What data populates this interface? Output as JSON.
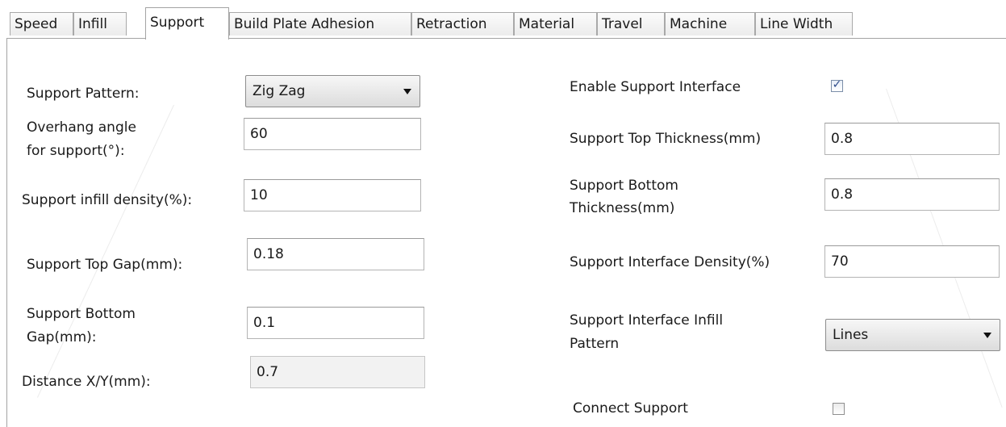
{
  "tabs": [
    {
      "label": "Speed",
      "active": false
    },
    {
      "label": "Infill",
      "active": false
    },
    {
      "label": "Support",
      "active": true
    },
    {
      "label": "Build Plate Adhesion",
      "active": false
    },
    {
      "label": "Retraction",
      "active": false
    },
    {
      "label": "Material",
      "active": false
    },
    {
      "label": "Travel",
      "active": false
    },
    {
      "label": "Machine",
      "active": false
    },
    {
      "label": "Line Width",
      "active": false
    }
  ],
  "left": {
    "support_pattern": {
      "label": "Support Pattern:",
      "value": "Zig Zag"
    },
    "overhang_angle": {
      "label_line1": "Overhang angle",
      "label_line2": "for support(°):",
      "value": "60"
    },
    "infill_density": {
      "label": "Support infill density(%):",
      "value": "10"
    },
    "top_gap": {
      "label": "Support Top Gap(mm):",
      "value": "0.18"
    },
    "bottom_gap": {
      "label_line1": "Support Bottom",
      "label_line2": "Gap(mm):",
      "value": "0.1"
    },
    "distance_xy": {
      "label": "Distance X/Y(mm):",
      "value": "0.7"
    }
  },
  "right": {
    "enable_interface": {
      "label": "Enable Support Interface",
      "checked": true
    },
    "top_thickness": {
      "label": "Support Top Thickness(mm)",
      "value": "0.8"
    },
    "bottom_thickness": {
      "label_line1": "Support Bottom",
      "label_line2": "Thickness(mm)",
      "value": "0.8"
    },
    "interface_density": {
      "label": "Support Interface Density(%)",
      "value": "70"
    },
    "interface_pattern": {
      "label_line1": "Support Interface Infill",
      "label_line2": "Pattern",
      "value": "Lines"
    },
    "connect_support": {
      "label": "Connect Support",
      "checked": false
    }
  },
  "colors": {
    "panel_border": "#a3a3a3",
    "check_mark": "#2c4a8a"
  },
  "icons": {
    "check": "check-icon",
    "dropdown": "chevron-down-icon"
  }
}
